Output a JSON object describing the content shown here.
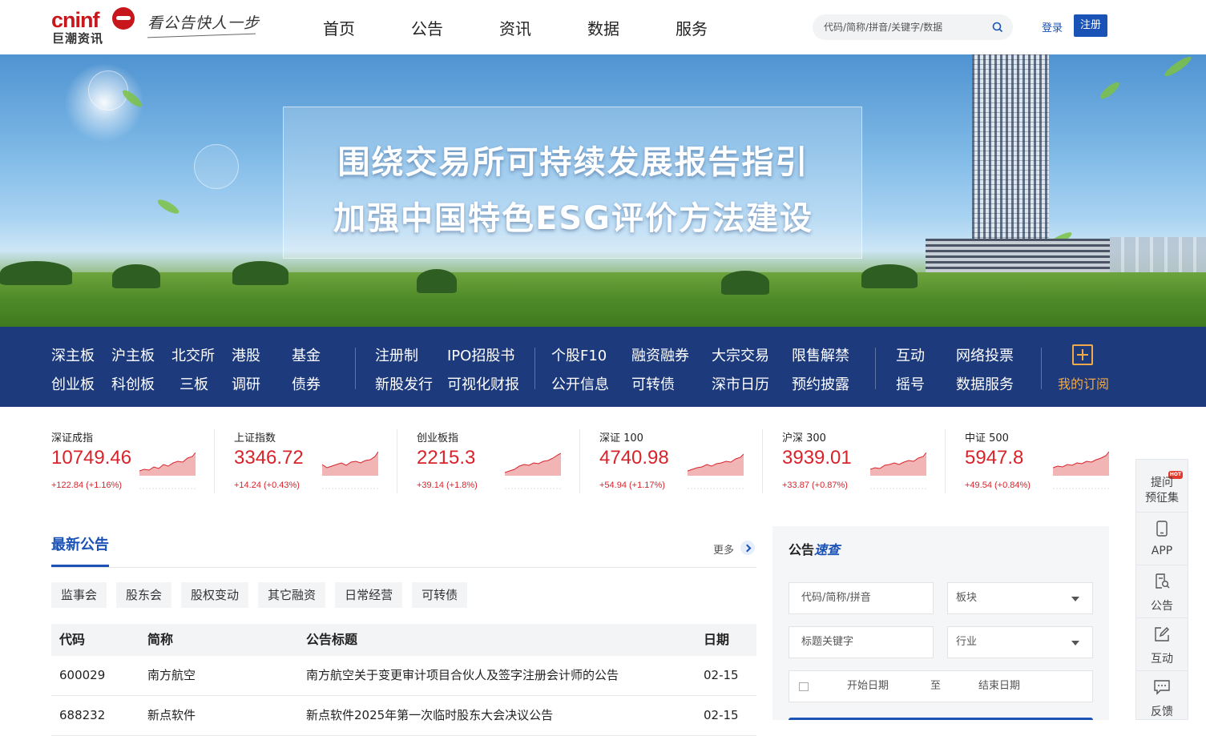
{
  "header": {
    "logo_text": "cninf",
    "logo_subtext": "巨潮资讯",
    "slogan": "看公告快人一步",
    "nav": [
      "首页",
      "公告",
      "资讯",
      "数据",
      "服务"
    ],
    "search_placeholder": "代码/简称/拼音/关键字/数据",
    "login": "登录",
    "register": "注册"
  },
  "banner": {
    "line1": "围绕交易所可持续发展报告指引",
    "line2": "加强中国特色ESG评价方法建设"
  },
  "quicklinks": {
    "g1": [
      [
        "深主板",
        "创业板"
      ],
      [
        "沪主板",
        "科创板"
      ],
      [
        "北交所",
        "三板"
      ],
      [
        "港股",
        "调研"
      ],
      [
        "基金",
        "债券"
      ]
    ],
    "g2": [
      [
        "注册制",
        "新股发行"
      ],
      [
        "IPO招股书",
        "可视化财报"
      ]
    ],
    "g3": [
      [
        "个股F10",
        "公开信息"
      ],
      [
        "融资融券",
        "可转债"
      ],
      [
        "大宗交易",
        "深市日历"
      ],
      [
        "限售解禁",
        "预约披露"
      ]
    ],
    "g4": [
      [
        "互动",
        "摇号"
      ],
      [
        "网络投票",
        "数据服务"
      ]
    ],
    "subscribe": "我的订阅",
    "accent_color": "#f1a94a"
  },
  "indices": [
    {
      "name": "深证成指",
      "value": "10749.46",
      "change": "+122.84 (+1.16%)"
    },
    {
      "name": "上证指数",
      "value": "3346.72",
      "change": "+14.24 (+0.43%)"
    },
    {
      "name": "创业板指",
      "value": "2215.3",
      "change": "+39.14 (+1.8%)"
    },
    {
      "name": "深证 100",
      "value": "4740.98",
      "change": "+54.94 (+1.17%)"
    },
    {
      "name": "沪深 300",
      "value": "3939.01",
      "change": "+33.87 (+0.87%)"
    },
    {
      "name": "中证 500",
      "value": "5947.8",
      "change": "+49.54 (+0.84%)"
    }
  ],
  "announcements": {
    "title": "最新公告",
    "more": "更多",
    "chips": [
      "监事会",
      "股东会",
      "股权变动",
      "其它融资",
      "日常经营",
      "可转债"
    ],
    "columns": [
      "代码",
      "简称",
      "公告标题",
      "日期"
    ],
    "rows": [
      [
        "600029",
        "南方航空",
        "南方航空关于变更审计项目合伙人及签字注册会计师的公告",
        "02-15"
      ],
      [
        "688232",
        "新点软件",
        "新点软件2025年第一次临时股东大会决议公告",
        "02-15"
      ]
    ]
  },
  "quick_search": {
    "title_plain": "公告",
    "title_emph": "速查",
    "code_placeholder": "代码/简称/拼音",
    "board": "板块",
    "keyword_placeholder": "标题关键字",
    "industry": "行业",
    "start_date": "开始日期",
    "to": "至",
    "end_date": "结束日期"
  },
  "float_toolbar": [
    {
      "label": "提问\n预征集",
      "badge": "HOT",
      "icon": "question-icon"
    },
    {
      "label": "APP",
      "icon": "phone-icon"
    },
    {
      "label": "公告",
      "icon": "document-search-icon"
    },
    {
      "label": "互动",
      "icon": "edit-icon"
    },
    {
      "label": "反馈",
      "icon": "chat-icon"
    }
  ],
  "colors": {
    "brand_red": "#c8161d",
    "brand_blue": "#1a53b5",
    "navy": "#1c3a7c",
    "up_red": "#d8232a"
  }
}
